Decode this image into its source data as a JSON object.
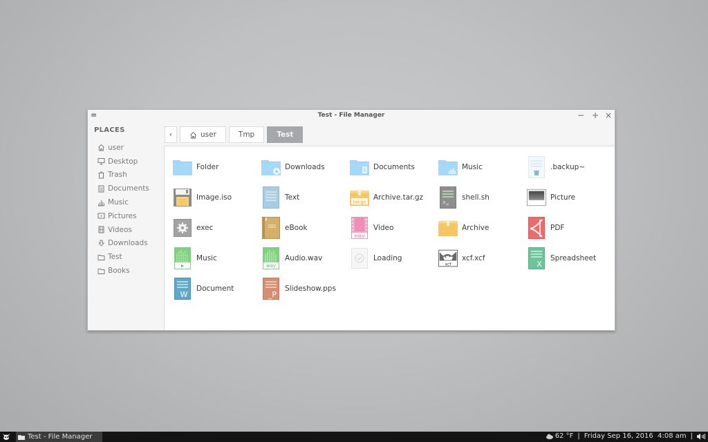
{
  "window": {
    "title": "Test - File Manager",
    "menu_icon": "hamburger-icon",
    "controls": {
      "minimize": "−",
      "maximize": "+",
      "close": "×"
    }
  },
  "sidebar": {
    "heading": "PLACES",
    "items": [
      {
        "label": "user",
        "icon": "home-icon"
      },
      {
        "label": "Desktop",
        "icon": "monitor-icon"
      },
      {
        "label": "Trash",
        "icon": "trash-icon"
      },
      {
        "label": "Documents",
        "icon": "document-icon"
      },
      {
        "label": "Music",
        "icon": "music-bars-icon"
      },
      {
        "label": "Pictures",
        "icon": "picture-icon"
      },
      {
        "label": "Videos",
        "icon": "film-icon"
      },
      {
        "label": "Downloads",
        "icon": "download-icon"
      },
      {
        "label": "Test",
        "icon": "folder-icon"
      },
      {
        "label": "Books",
        "icon": "folder-icon"
      }
    ]
  },
  "breadcrumbs": {
    "back": "‹",
    "items": [
      {
        "label": "user",
        "icon": "home-icon"
      },
      {
        "label": "Tmp"
      },
      {
        "label": "Test",
        "active": true
      }
    ]
  },
  "files": [
    {
      "label": "Folder",
      "type": "folder"
    },
    {
      "label": "Downloads",
      "type": "folder-downloads"
    },
    {
      "label": "Documents",
      "type": "folder-documents"
    },
    {
      "label": "Music",
      "type": "folder-music"
    },
    {
      "label": ".backup~",
      "type": "backup"
    },
    {
      "label": "Image.iso",
      "type": "disk-image"
    },
    {
      "label": "Text",
      "type": "text"
    },
    {
      "label": "Archive.tar.gz",
      "type": "targz",
      "badge": "tar.gz"
    },
    {
      "label": "shell.sh",
      "type": "shell"
    },
    {
      "label": "Picture",
      "type": "picture"
    },
    {
      "label": "exec",
      "type": "executable"
    },
    {
      "label": "eBook",
      "type": "ebook"
    },
    {
      "label": "Video",
      "type": "video",
      "badge": "mkv"
    },
    {
      "label": "Archive",
      "type": "archive"
    },
    {
      "label": "PDF",
      "type": "pdf"
    },
    {
      "label": "Music",
      "type": "audio"
    },
    {
      "label": "Audio.wav",
      "type": "wav",
      "badge": "wav"
    },
    {
      "label": "Loading",
      "type": "loading"
    },
    {
      "label": "xcf.xcf",
      "type": "xcf",
      "badge": "xcf"
    },
    {
      "label": "Spreadsheet",
      "type": "spreadsheet",
      "badge": "X"
    },
    {
      "label": "Document",
      "type": "word",
      "badge": "W"
    },
    {
      "label": "Slideshow.pps",
      "type": "slideshow",
      "badge": "P"
    }
  ],
  "taskbar": {
    "task_label": "Test - File Manager",
    "weather": "62 °F",
    "separator": "|",
    "datetime": "Friday Sep 16, 2016  4:08 am"
  },
  "colors": {
    "folder": "#8ecdf2",
    "active_crumb": "#a4a8ac",
    "taskbar": "#141414"
  }
}
